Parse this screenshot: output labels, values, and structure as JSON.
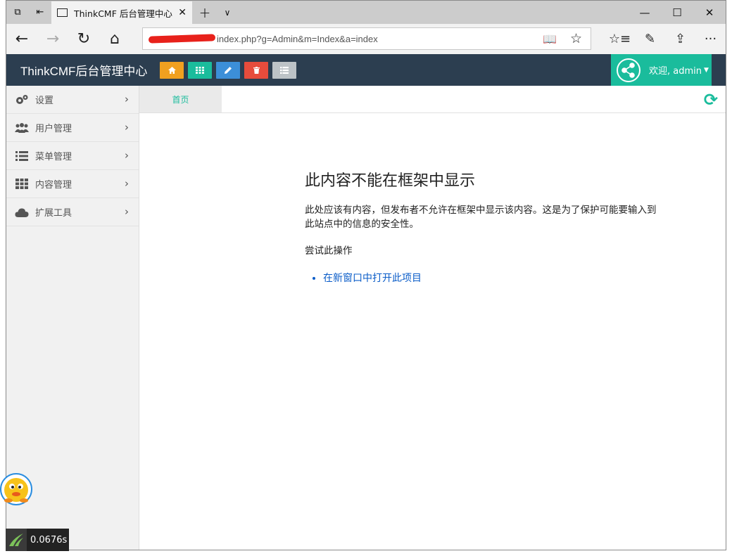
{
  "browser": {
    "tab_title": "ThinkCMF 后台管理中心",
    "url": "index.php?g=Admin&m=Index&a=index"
  },
  "app": {
    "brand": "ThinkCMF后台管理中心",
    "welcome": "欢迎, admin",
    "header_buttons": [
      {
        "icon": "home-icon",
        "color": "#f0a020"
      },
      {
        "icon": "grid-icon",
        "color": "#1abc9c"
      },
      {
        "icon": "pencil-icon",
        "color": "#3c8fd8"
      },
      {
        "icon": "trash-icon",
        "color": "#e74c3c"
      },
      {
        "icon": "list-icon",
        "color": "#bdc3c7"
      }
    ]
  },
  "sidebar": {
    "items": [
      {
        "label": "设置",
        "icon": "gears-icon"
      },
      {
        "label": "用户管理",
        "icon": "users-icon"
      },
      {
        "label": "菜单管理",
        "icon": "list-icon"
      },
      {
        "label": "内容管理",
        "icon": "grid-icon"
      },
      {
        "label": "扩展工具",
        "icon": "cloud-icon"
      }
    ]
  },
  "main": {
    "home_tab": "首页",
    "error": {
      "title": "此内容不能在框架中显示",
      "desc": "此处应该有内容，但发布者不允许在框架中显示该内容。这是为了保护可能要输入到此站点中的信息的安全性。",
      "try": "尝试此操作",
      "link": "在新窗口中打开此项目"
    }
  },
  "overlay": {
    "timer": "0.0676s"
  },
  "colors": {
    "header_bg": "#2c3e50",
    "accent": "#1abc9c",
    "link": "#0a5cc8"
  }
}
